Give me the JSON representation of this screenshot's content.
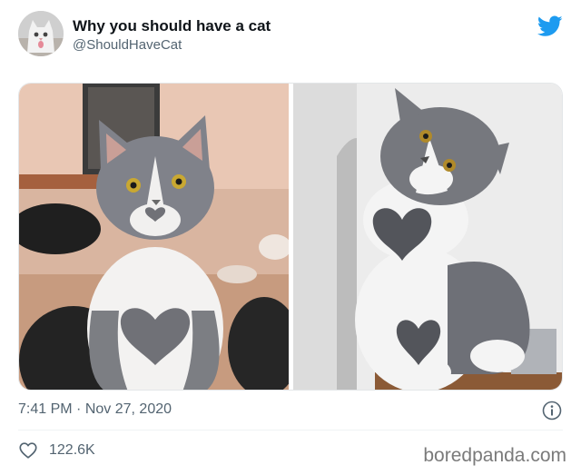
{
  "colors": {
    "twitter_blue": "#1d9bf0",
    "text_primary": "#0f1419",
    "text_secondary": "#536471",
    "divider": "#eff3f4"
  },
  "author": {
    "display_name": "Why you should have a cat",
    "handle": "@ShouldHaveCat",
    "avatar_icon": "cat-avatar"
  },
  "brand_icon": "twitter-bird-icon",
  "media": {
    "photos": [
      {
        "subject": "grey-and-white-cat-front"
      },
      {
        "subject": "grey-and-white-cat-side"
      }
    ]
  },
  "meta": {
    "time": "7:41 PM",
    "separator": "·",
    "date": "Nov 27, 2020",
    "info_icon": "info-icon"
  },
  "actions": {
    "like_icon": "heart-icon",
    "like_count": "122.6K"
  },
  "watermark": "boredpanda.com"
}
